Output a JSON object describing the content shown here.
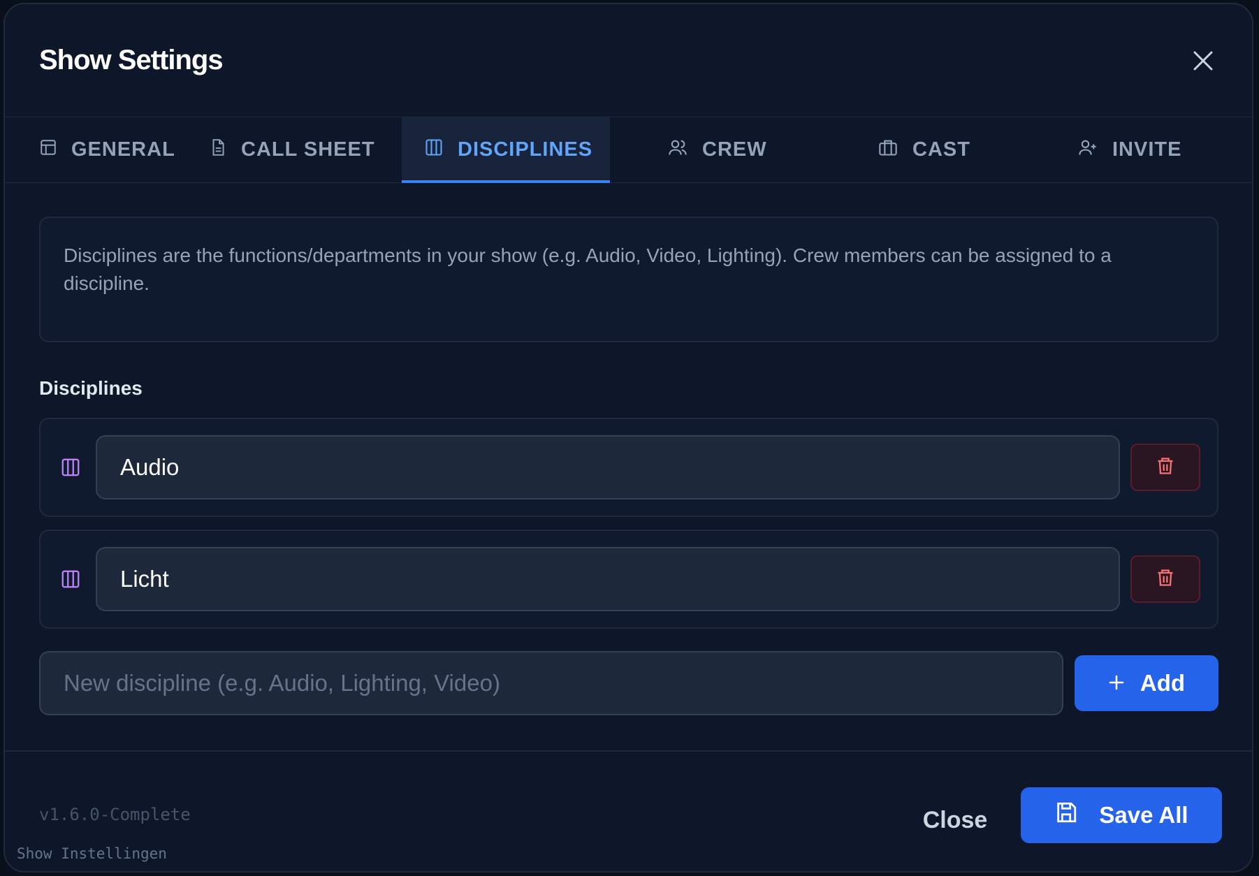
{
  "dialog": {
    "title": "Show Settings"
  },
  "tabs": [
    {
      "label": "GENERAL",
      "icon": "layout-icon"
    },
    {
      "label": "CALL SHEET",
      "icon": "document-icon"
    },
    {
      "label": "DISCIPLINES",
      "icon": "columns-icon",
      "active": true
    },
    {
      "label": "CREW",
      "icon": "users-icon"
    },
    {
      "label": "CAST",
      "icon": "briefcase-icon"
    },
    {
      "label": "INVITE",
      "icon": "user-plus-icon"
    }
  ],
  "info": {
    "text": "Disciplines are the functions/departments in your show (e.g. Audio, Video, Lighting). Crew members can be assigned to a discipline."
  },
  "disciplines": {
    "section_label": "Disciplines",
    "items": [
      {
        "name": "Audio"
      },
      {
        "name": "Licht"
      }
    ],
    "new_placeholder": "New discipline (e.g. Audio, Lighting, Video)",
    "add_label": "Add"
  },
  "footer": {
    "version": "v1.6.0-Complete",
    "locale_label": "Show Instellingen",
    "close_label": "Close",
    "save_label": "Save All"
  },
  "colors": {
    "accent": "#2563eb",
    "active_tab": "#60a5fa",
    "discipline_icon": "#c084fc",
    "danger": "#f87171"
  }
}
